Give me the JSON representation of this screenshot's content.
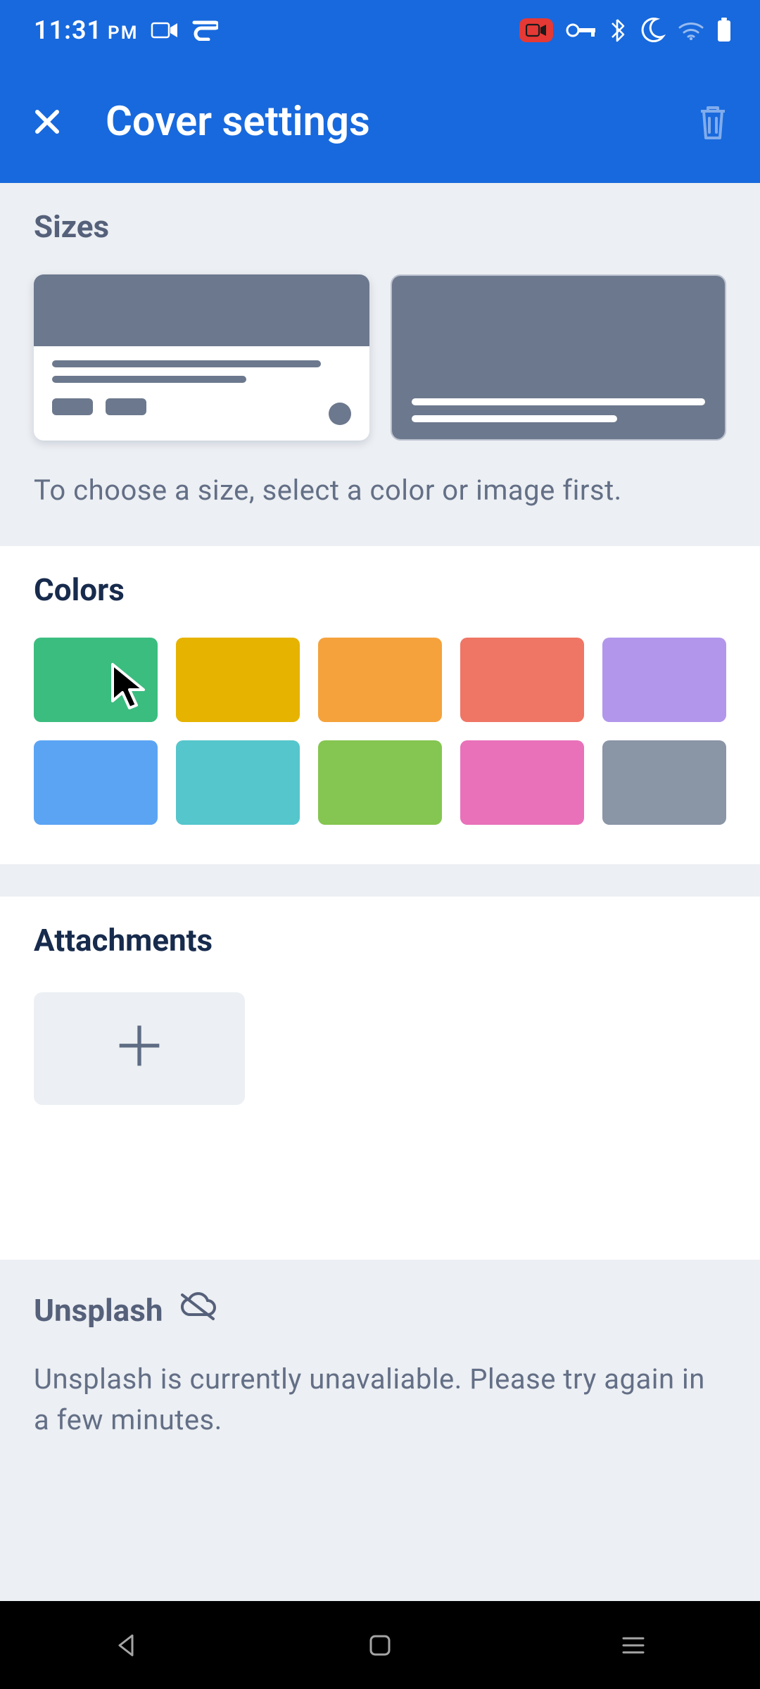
{
  "status": {
    "time": "11:31",
    "ampm": "PM"
  },
  "header": {
    "title": "Cover settings"
  },
  "sizes": {
    "label": "Sizes",
    "hint": "To choose a size, select a color or image first."
  },
  "colors": {
    "label": "Colors",
    "swatches": [
      "#3bbd7f",
      "#e6b300",
      "#f5a23c",
      "#ef7564",
      "#b296eb",
      "#5ba4f3",
      "#55c6cc",
      "#84c651",
      "#e971ba",
      "#8a95a6"
    ]
  },
  "attachments": {
    "label": "Attachments"
  },
  "unsplash": {
    "label": "Unsplash",
    "message": "Unsplash is currently unavaliable. Please try again in a few minutes."
  }
}
